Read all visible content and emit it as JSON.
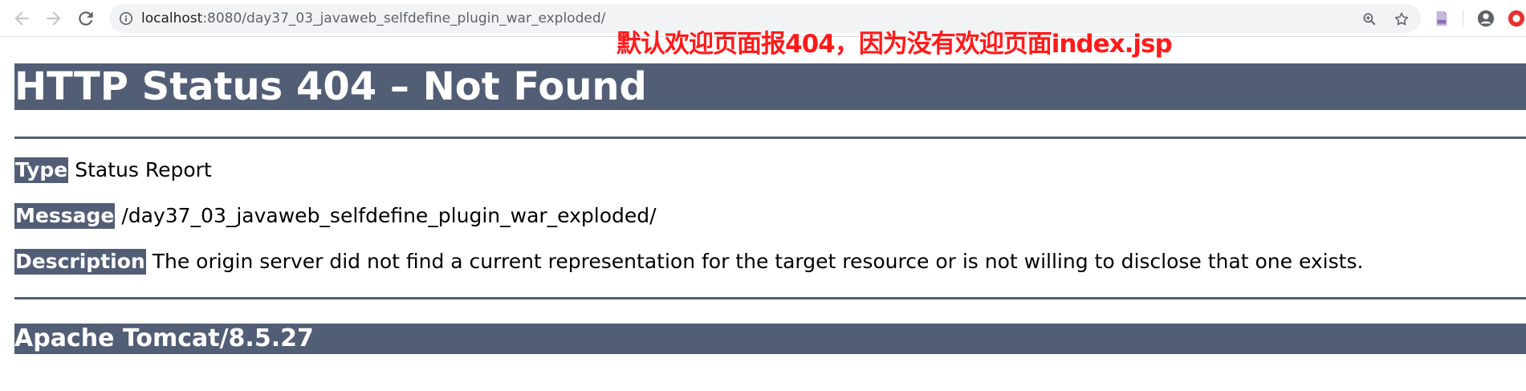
{
  "browser": {
    "url_host": "localhost",
    "url_rest": ":8080/day37_03_javaweb_selfdefine_plugin_war_exploded/",
    "icons": [
      "back-icon",
      "forward-icon",
      "reload-icon",
      "info-icon",
      "zoom-icon",
      "star-icon",
      "pdf-extension-icon",
      "profile-icon",
      "opera-extension-icon"
    ]
  },
  "annotation": {
    "text": "默认欢迎页面报404，因为没有欢迎页面index.jsp",
    "color": "#ff1a1a"
  },
  "error_page": {
    "title": "HTTP Status 404 – Not Found",
    "accent_color": "#525d76",
    "type_label": "Type",
    "type_value": "Status Report",
    "message_label": "Message",
    "message_value": "/day37_03_javaweb_selfdefine_plugin_war_exploded/",
    "description_label": "Description",
    "description_value": "The origin server did not find a current representation for the target resource or is not willing to disclose that one exists.",
    "server": "Apache Tomcat/8.5.27"
  }
}
